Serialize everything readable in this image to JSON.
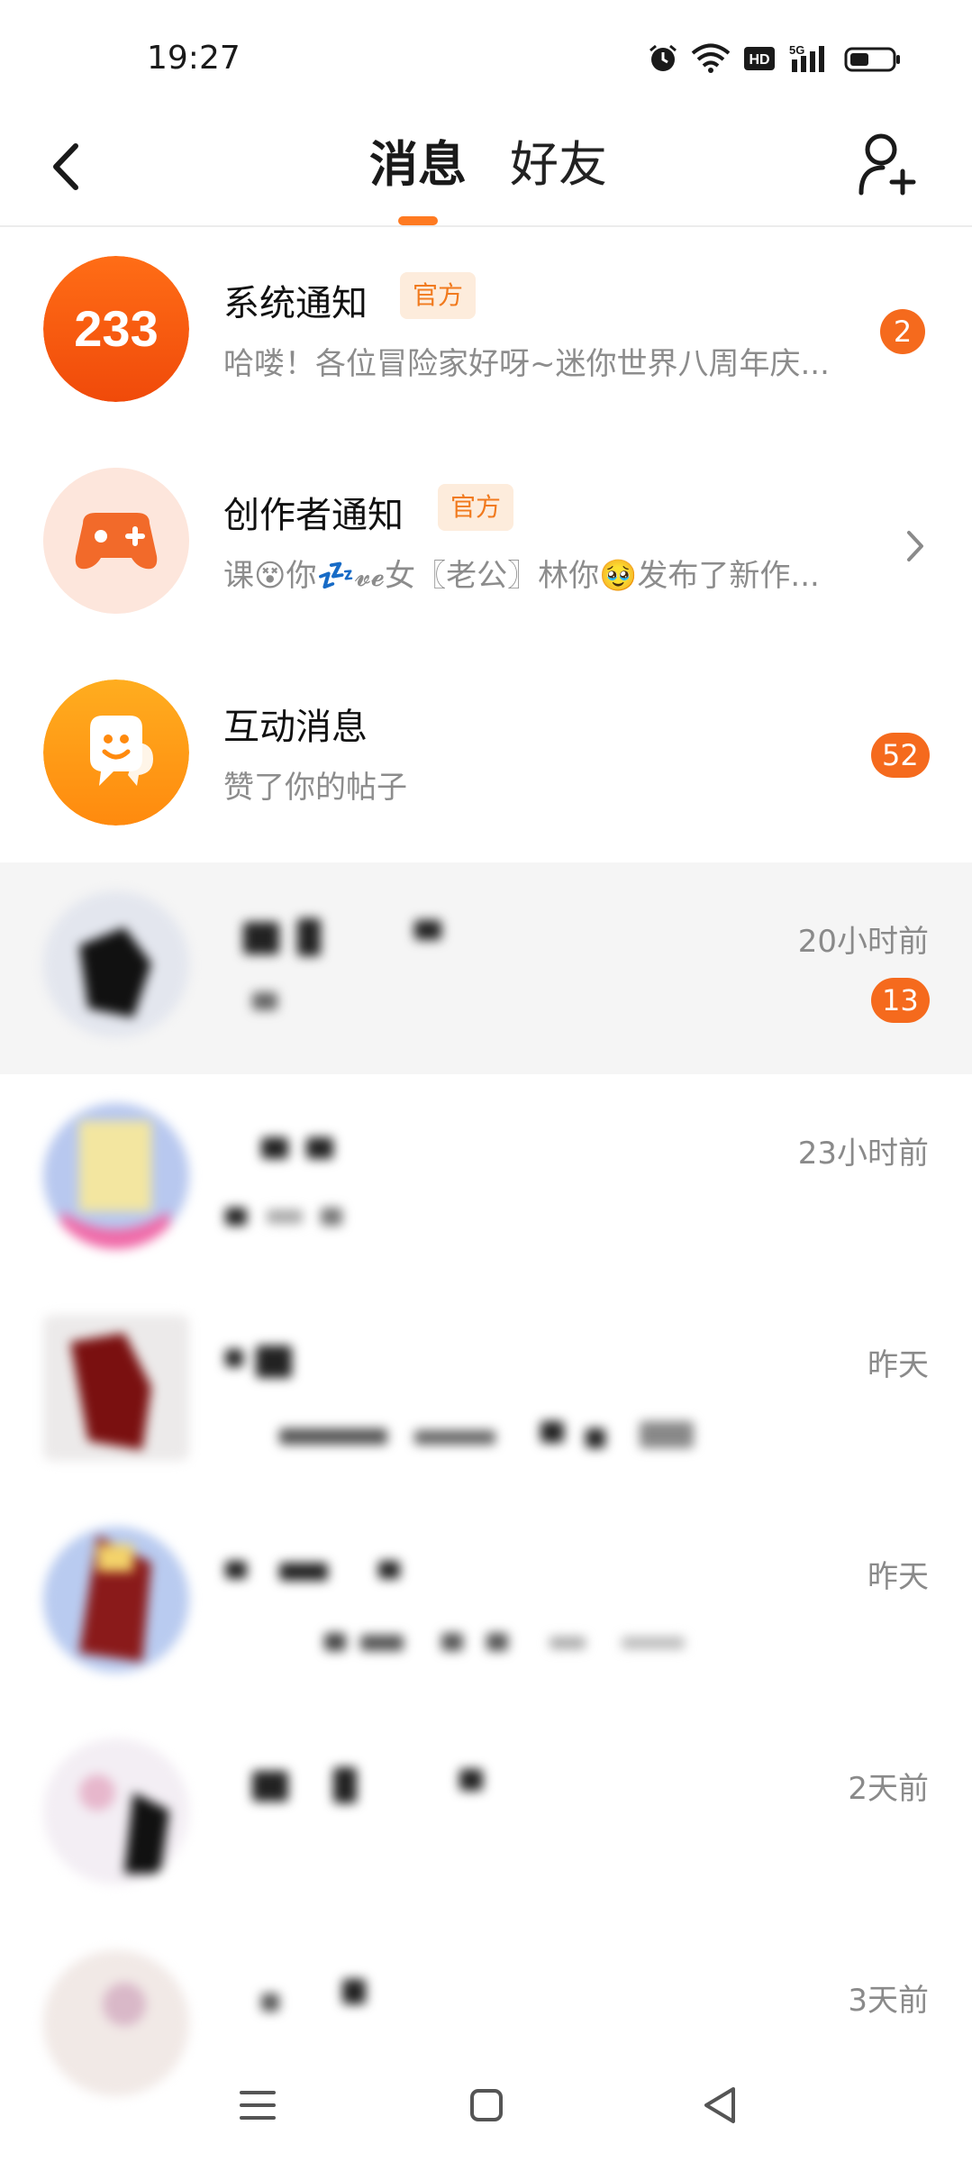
{
  "status_bar": {
    "time": "19:27",
    "icons": [
      "alarm-icon",
      "wifi-icon",
      "hd-icon",
      "signal-5g-icon",
      "battery-icon"
    ],
    "hd_label": "HD",
    "network_label": "5G"
  },
  "header": {
    "tabs": [
      {
        "label": "消息",
        "active": true
      },
      {
        "label": "好友",
        "active": false
      }
    ],
    "accent_color": "#ff7a21"
  },
  "pinned": [
    {
      "title": "系统通知",
      "tag": "官方",
      "preview": "哈喽！各位冒险家好呀~迷你世界八周年庆...",
      "badge": "2",
      "avatar_text": "233"
    },
    {
      "title": "创作者通知",
      "tag": "官方",
      "preview": "课😵你💤𝓿𝓮女〖老公〗林你🥹发布了新作..."
    },
    {
      "title": "互动消息",
      "preview": "赞了你的帖子",
      "badge": "52"
    }
  ],
  "conversations": [
    {
      "time": "20小时前",
      "badge": "13"
    },
    {
      "time": "23小时前"
    },
    {
      "time": "昨天"
    },
    {
      "time": "昨天"
    },
    {
      "time": "2天前"
    },
    {
      "time": "3天前"
    }
  ]
}
